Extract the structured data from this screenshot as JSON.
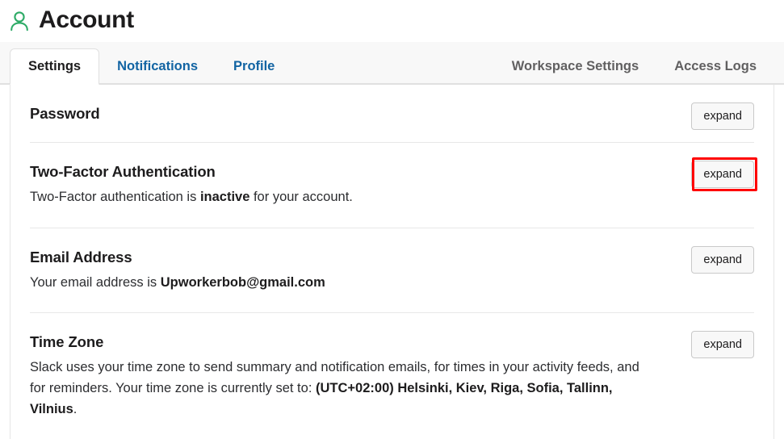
{
  "header": {
    "title": "Account",
    "icon": "user-icon",
    "icon_color": "#2eab67"
  },
  "tabs": {
    "left": [
      {
        "label": "Settings",
        "active": true
      },
      {
        "label": "Notifications",
        "active": false
      },
      {
        "label": "Profile",
        "active": false
      }
    ],
    "right": [
      {
        "label": "Workspace Settings"
      },
      {
        "label": "Access Logs"
      }
    ]
  },
  "sections": [
    {
      "id": "password",
      "title": "Password",
      "description": "",
      "button_label": "expand",
      "highlighted": false
    },
    {
      "id": "twofactor",
      "title": "Two-Factor Authentication",
      "description_prefix": "Two-Factor authentication is ",
      "description_strong": "inactive",
      "description_suffix": " for your account.",
      "button_label": "expand",
      "highlighted": true,
      "highlight_color": "#ff0000"
    },
    {
      "id": "email",
      "title": "Email Address",
      "description_prefix": "Your email address is ",
      "description_strong": "Upworkerbob@gmail.com",
      "description_suffix": "",
      "button_label": "expand",
      "highlighted": false
    },
    {
      "id": "timezone",
      "title": "Time Zone",
      "description_prefix": "Slack uses your time zone to send summary and notification emails, for times in your activity feeds, and for reminders. Your time zone is currently set to: ",
      "description_strong": "(UTC+02:00) Helsinki, Kiev, Riga, Sofia, Tallinn, Vilnius",
      "description_suffix": ".",
      "button_label": "expand",
      "highlighted": false
    }
  ],
  "colors": {
    "link": "#1264a3",
    "muted_tab": "#616061",
    "text": "#1d1c1d",
    "accent_green": "#2eab67",
    "highlight_red": "#ff0000"
  }
}
